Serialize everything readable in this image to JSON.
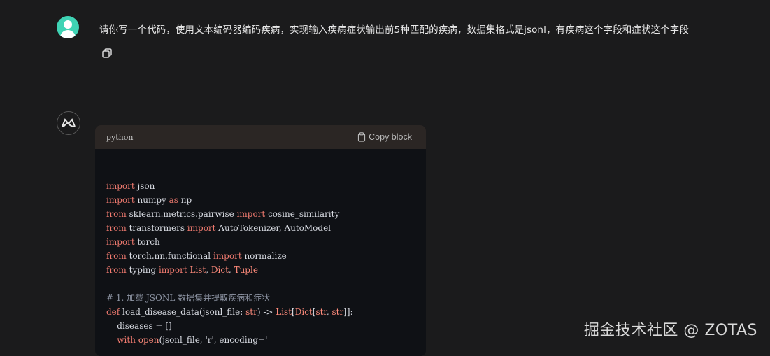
{
  "user_message": {
    "text": "请你写一个代码，使用文本编码器编码疾病，实现输入疾病症状输出前5种匹配的疾病，数据集格式是jsonl，有疾病这个字段和症状这个字段"
  },
  "code_block": {
    "language": "python",
    "copy_label": "Copy block",
    "lines": [
      [
        [
          "import",
          "kw"
        ],
        [
          " json",
          ""
        ]
      ],
      [
        [
          "import",
          "kw"
        ],
        [
          " numpy ",
          ""
        ],
        [
          "as",
          "kw"
        ],
        [
          " np",
          ""
        ]
      ],
      [
        [
          "from",
          "kw"
        ],
        [
          " sklearn.metrics.pairwise ",
          ""
        ],
        [
          "import",
          "kw"
        ],
        [
          " cosine_similarity",
          ""
        ]
      ],
      [
        [
          "from",
          "kw"
        ],
        [
          " transformers ",
          ""
        ],
        [
          "import",
          "kw"
        ],
        [
          " AutoTokenizer, AutoModel",
          ""
        ]
      ],
      [
        [
          "import",
          "kw"
        ],
        [
          " torch",
          ""
        ]
      ],
      [
        [
          "from",
          "kw"
        ],
        [
          " torch.nn.functional ",
          ""
        ],
        [
          "import",
          "kw"
        ],
        [
          " normalize",
          ""
        ]
      ],
      [
        [
          "from",
          "kw"
        ],
        [
          " typing ",
          ""
        ],
        [
          "import",
          "kw"
        ],
        [
          " ",
          ""
        ],
        [
          "List",
          "ty"
        ],
        [
          ", ",
          ""
        ],
        [
          "Dict",
          "ty"
        ],
        [
          ", ",
          ""
        ],
        [
          "Tuple",
          "ty"
        ]
      ],
      [
        [
          "",
          ""
        ]
      ],
      [
        [
          "# 1. 加载 JSONL 数据集并提取疾病和症状",
          "cm"
        ]
      ],
      [
        [
          "def",
          "kw"
        ],
        [
          " load_disease_data(jsonl_file: ",
          ""
        ],
        [
          "str",
          "ty"
        ],
        [
          ") -> ",
          ""
        ],
        [
          "List",
          "ty"
        ],
        [
          "[",
          ""
        ],
        [
          "Dict",
          "ty"
        ],
        [
          "[",
          ""
        ],
        [
          "str",
          "ty"
        ],
        [
          ", ",
          ""
        ],
        [
          "str",
          "ty"
        ],
        [
          "]]:",
          ""
        ]
      ],
      [
        [
          "    diseases = []",
          ""
        ]
      ],
      [
        [
          "    ",
          ""
        ],
        [
          "with",
          "kw"
        ],
        [
          " ",
          ""
        ],
        [
          "open",
          "ty"
        ],
        [
          "(jsonl_file, 'r', encoding='",
          ""
        ]
      ]
    ]
  },
  "watermark": "掘金技术社区 @ ZOTAS",
  "colors": {
    "avatar": "#3fd3b4",
    "keyword": "#f07a6f",
    "code_bg": "#0f1115",
    "header_bg": "#2b2624"
  },
  "icons": {
    "user_avatar": "user-avatar-icon",
    "copy_message": "copy-icon",
    "assistant_avatar": "assistant-logo-icon",
    "copy_block": "clipboard-icon"
  }
}
